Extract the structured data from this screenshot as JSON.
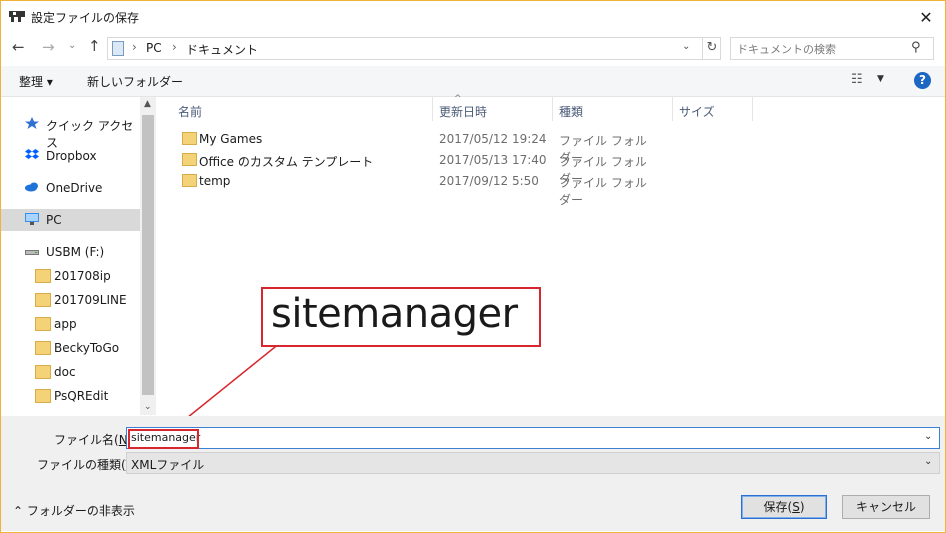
{
  "window": {
    "title": "設定ファイルの保存",
    "close_glyph": "✕"
  },
  "nav": {
    "back_glyph": "←",
    "forward_glyph": "→",
    "recent_glyph": "⌄",
    "up_glyph": "↑",
    "address": {
      "crumbs": [
        "PC",
        "ドキュメント"
      ],
      "separator": "›",
      "dropdown_glyph": "⌄",
      "refresh_glyph": "↻"
    },
    "search": {
      "placeholder": "ドキュメントの検索",
      "icon_glyph": "⚲"
    }
  },
  "toolbar": {
    "organize_label": "整理 ▾",
    "new_folder_label": "新しいフォルダー",
    "view_glyph": "☷",
    "view_dropdown_glyph": "▼",
    "help_label": "?"
  },
  "sidebar": {
    "items": [
      {
        "label": "クイック アクセス"
      },
      {
        "label": "Dropbox"
      },
      {
        "label": "OneDrive"
      },
      {
        "label": "PC"
      },
      {
        "label": "USBM (F:)"
      },
      {
        "label": "201708ip"
      },
      {
        "label": "201709LINE"
      },
      {
        "label": "app"
      },
      {
        "label": "BeckyToGo"
      },
      {
        "label": "doc"
      },
      {
        "label": "PsQREdit"
      }
    ],
    "scroll_up_glyph": "▲",
    "scroll_down_glyph": "⌄"
  },
  "file_list": {
    "columns": [
      "名前",
      "更新日時",
      "種類",
      "サイズ"
    ],
    "sort_glyph": "^",
    "rows": [
      {
        "name": "My Games",
        "modified": "2017/05/12 19:24",
        "type": "ファイル フォルダー"
      },
      {
        "name": "Office のカスタム テンプレート",
        "modified": "2017/05/13 17:40",
        "type": "ファイル フォルダー"
      },
      {
        "name": "temp",
        "modified": "2017/09/12 5:50",
        "type": "ファイル フォルダー"
      }
    ]
  },
  "callout": {
    "text": "sitemanager",
    "color": "#d7262d"
  },
  "form": {
    "filename_label_pre": "ファイル名(",
    "filename_label_key": "N",
    "filename_label_post": "):",
    "filename_value": "sitemanager",
    "filetype_label_pre": "ファイルの種類(",
    "filetype_label_key": "T",
    "filetype_label_post": "):",
    "filetype_value": "XMLファイル",
    "dropdown_glyph": "⌄",
    "hide_folders_label": "⌃ フォルダーの非表示",
    "save_label_pre": "保存(",
    "save_label_key": "S",
    "save_label_post": ")",
    "cancel_label": "キャンセル"
  },
  "colors": {
    "accent": "#1c66c4",
    "window_border": "#f0b33a",
    "folder": "#f4d277",
    "highlight": "#d7262d"
  }
}
